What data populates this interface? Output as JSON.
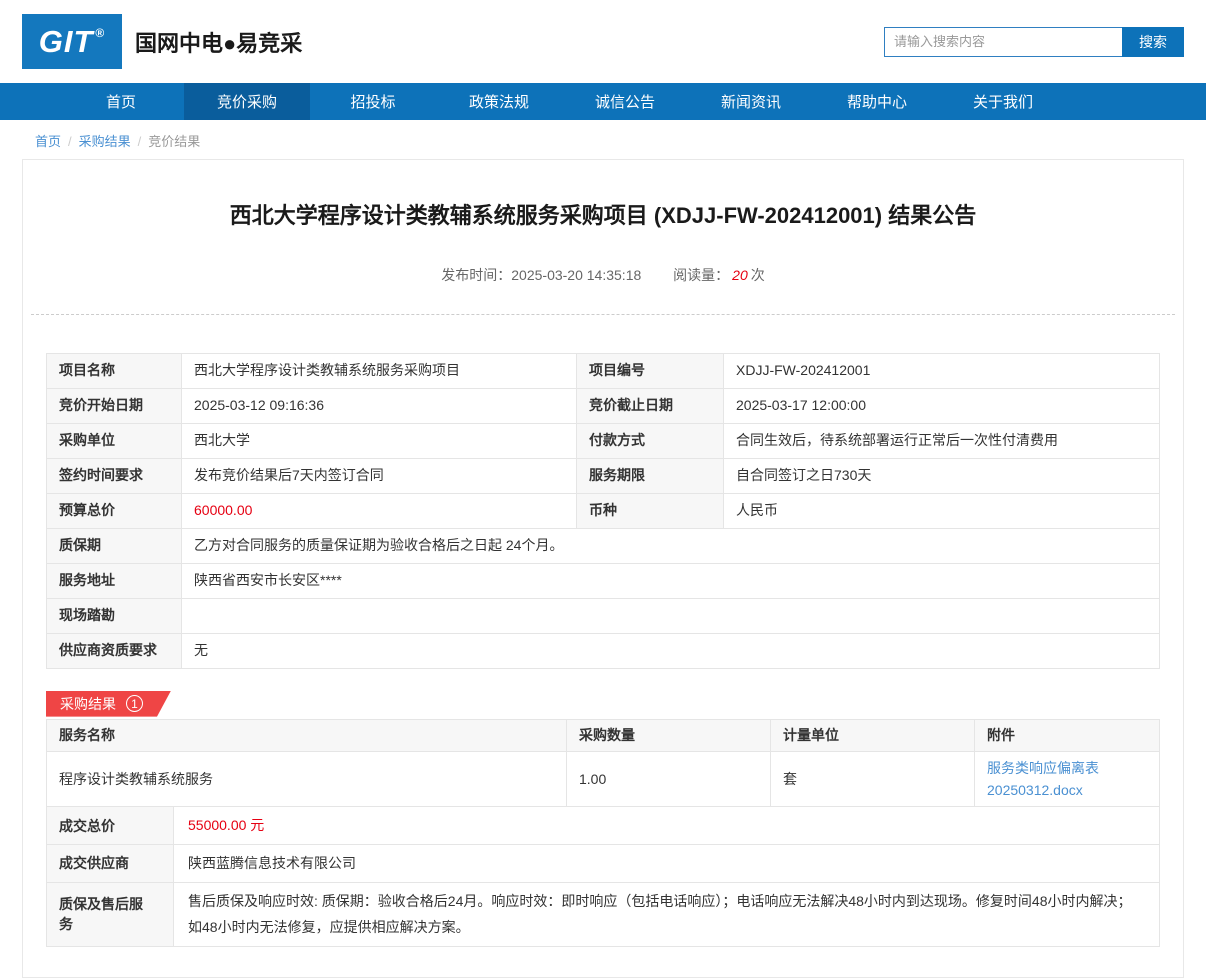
{
  "colors": {
    "brand-blue": "#0d72b9",
    "nav-active": "#0a5d9c",
    "logo-blue": "#1478be",
    "link-blue": "#4a90d2",
    "price-red": "#e60012",
    "ribbon-red": "#ef4545",
    "label-bg": "#f7f7f7",
    "border": "#e5e5e5"
  },
  "header": {
    "logo_text": "GIT",
    "logo_reg": "®",
    "brand": "国网中电●易竞采",
    "search_placeholder": "请输入搜索内容",
    "search_button": "搜索"
  },
  "nav": {
    "items": [
      {
        "label": "首页"
      },
      {
        "label": "竞价采购"
      },
      {
        "label": "招投标"
      },
      {
        "label": "政策法规"
      },
      {
        "label": "诚信公告"
      },
      {
        "label": "新闻资讯"
      },
      {
        "label": "帮助中心"
      },
      {
        "label": "关于我们"
      }
    ]
  },
  "breadcrumb": {
    "separator": "/",
    "items": [
      "首页",
      "采购结果",
      "竞价结果"
    ]
  },
  "article": {
    "title": "西北大学程序设计类教辅系统服务采购项目 (XDJJ-FW-202412001) 结果公告",
    "publish_label": "发布时间：",
    "publish_time": "2025-03-20 14:35:18",
    "views_label": "阅读量：",
    "views_count": "20",
    "views_unit": "次"
  },
  "info_table": {
    "paired_rows": [
      {
        "l1": "项目名称",
        "v1": "西北大学程序设计类教辅系统服务采购项目",
        "l2": "项目编号",
        "v2": "XDJJ-FW-202412001"
      },
      {
        "l1": "竞价开始日期",
        "v1": "2025-03-12 09:16:36",
        "l2": "竞价截止日期",
        "v2": "2025-03-17 12:00:00"
      },
      {
        "l1": "采购单位",
        "v1": "西北大学",
        "l2": "付款方式",
        "v2": "合同生效后，待系统部署运行正常后一次性付清费用"
      },
      {
        "l1": "签约时间要求",
        "v1": "发布竞价结果后7天内签订合同",
        "l2": "服务期限",
        "v2": "自合同签订之日730天"
      },
      {
        "l1": "预算总价",
        "v1": "60000.00",
        "l2": "币种",
        "v2": "人民币"
      }
    ],
    "full_rows": [
      {
        "label": "质保期",
        "value": "乙方对合同服务的质量保证期为验收合格后之日起 24个月。"
      },
      {
        "label": "服务地址",
        "value": "陕西省西安市长安区****"
      },
      {
        "label": "现场踏勘",
        "value": ""
      },
      {
        "label": "供应商资质要求",
        "value": "无"
      }
    ]
  },
  "result_section": {
    "badge_label": "采购结果",
    "badge_count": "1",
    "table": {
      "headers": [
        "服务名称",
        "采购数量",
        "计量单位",
        "附件"
      ],
      "row": {
        "name": "程序设计类教辅系统服务",
        "qty": "1.00",
        "unit": "套",
        "attachment": "服务类响应偏离表 20250312.docx"
      }
    },
    "summary": [
      {
        "label": "成交总价",
        "value": "55000.00 元"
      },
      {
        "label": "成交供应商",
        "value": "陕西蓝腾信息技术有限公司"
      },
      {
        "label": "质保及售后服务",
        "value": "售后质保及响应时效: 质保期：验收合格后24月。响应时效：即时响应（包括电话响应）；电话响应无法解决48小时内到达现场。修复时间48小时内解决；如48小时内无法修复，应提供相应解决方案。"
      }
    ]
  }
}
